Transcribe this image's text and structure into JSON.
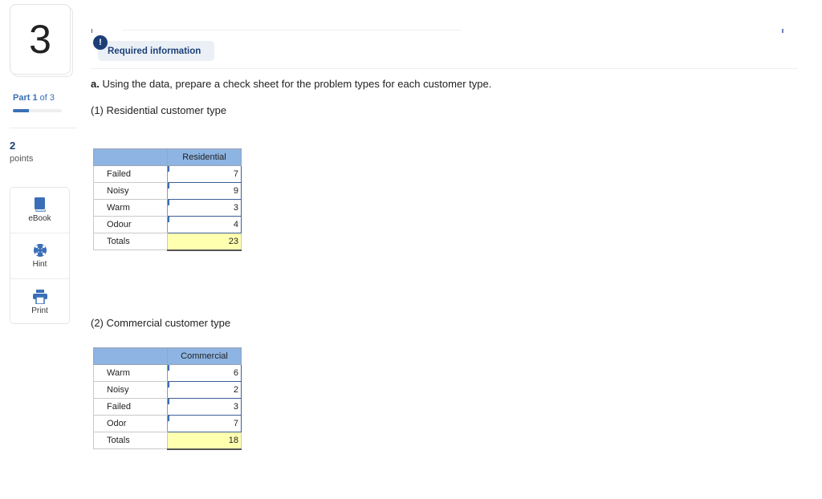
{
  "sidebar": {
    "question_number": "3",
    "part": {
      "prefix": "Part",
      "current": "1",
      "of_text": "of 3",
      "progress_fraction": 0.333
    },
    "points_value": "2",
    "points_label": "points",
    "tools": [
      {
        "label": "eBook",
        "icon": "book-icon"
      },
      {
        "label": "Hint",
        "icon": "lifebuoy-icon"
      },
      {
        "label": "Print",
        "icon": "printer-icon"
      }
    ]
  },
  "header": {
    "required_icon": "!",
    "required_label": "Required information"
  },
  "question": {
    "prefix": "a.",
    "text": " Using the data, prepare a check sheet for the problem types for each customer type."
  },
  "residential": {
    "title": "(1) Residential customer type",
    "column_header": "Residential",
    "rows": [
      {
        "label": "Failed",
        "value": "7"
      },
      {
        "label": "Noisy",
        "value": "9"
      },
      {
        "label": "Warm",
        "value": "3"
      },
      {
        "label": "Odour",
        "value": "4"
      }
    ],
    "total_label": "Totals",
    "total_value": "23"
  },
  "commercial": {
    "title": "(2) Commercial customer type",
    "column_header": "Commercial",
    "rows": [
      {
        "label": "Warm",
        "value": "6"
      },
      {
        "label": "Noisy",
        "value": "2"
      },
      {
        "label": "Failed",
        "value": "3"
      },
      {
        "label": "Odor",
        "value": "7"
      }
    ],
    "total_label": "Totals",
    "total_value": "18"
  },
  "colors": {
    "accent": "#3a6fb8",
    "navy": "#1c3f77",
    "table_header": "#8db4e2",
    "total_fill": "#ffffb0"
  }
}
